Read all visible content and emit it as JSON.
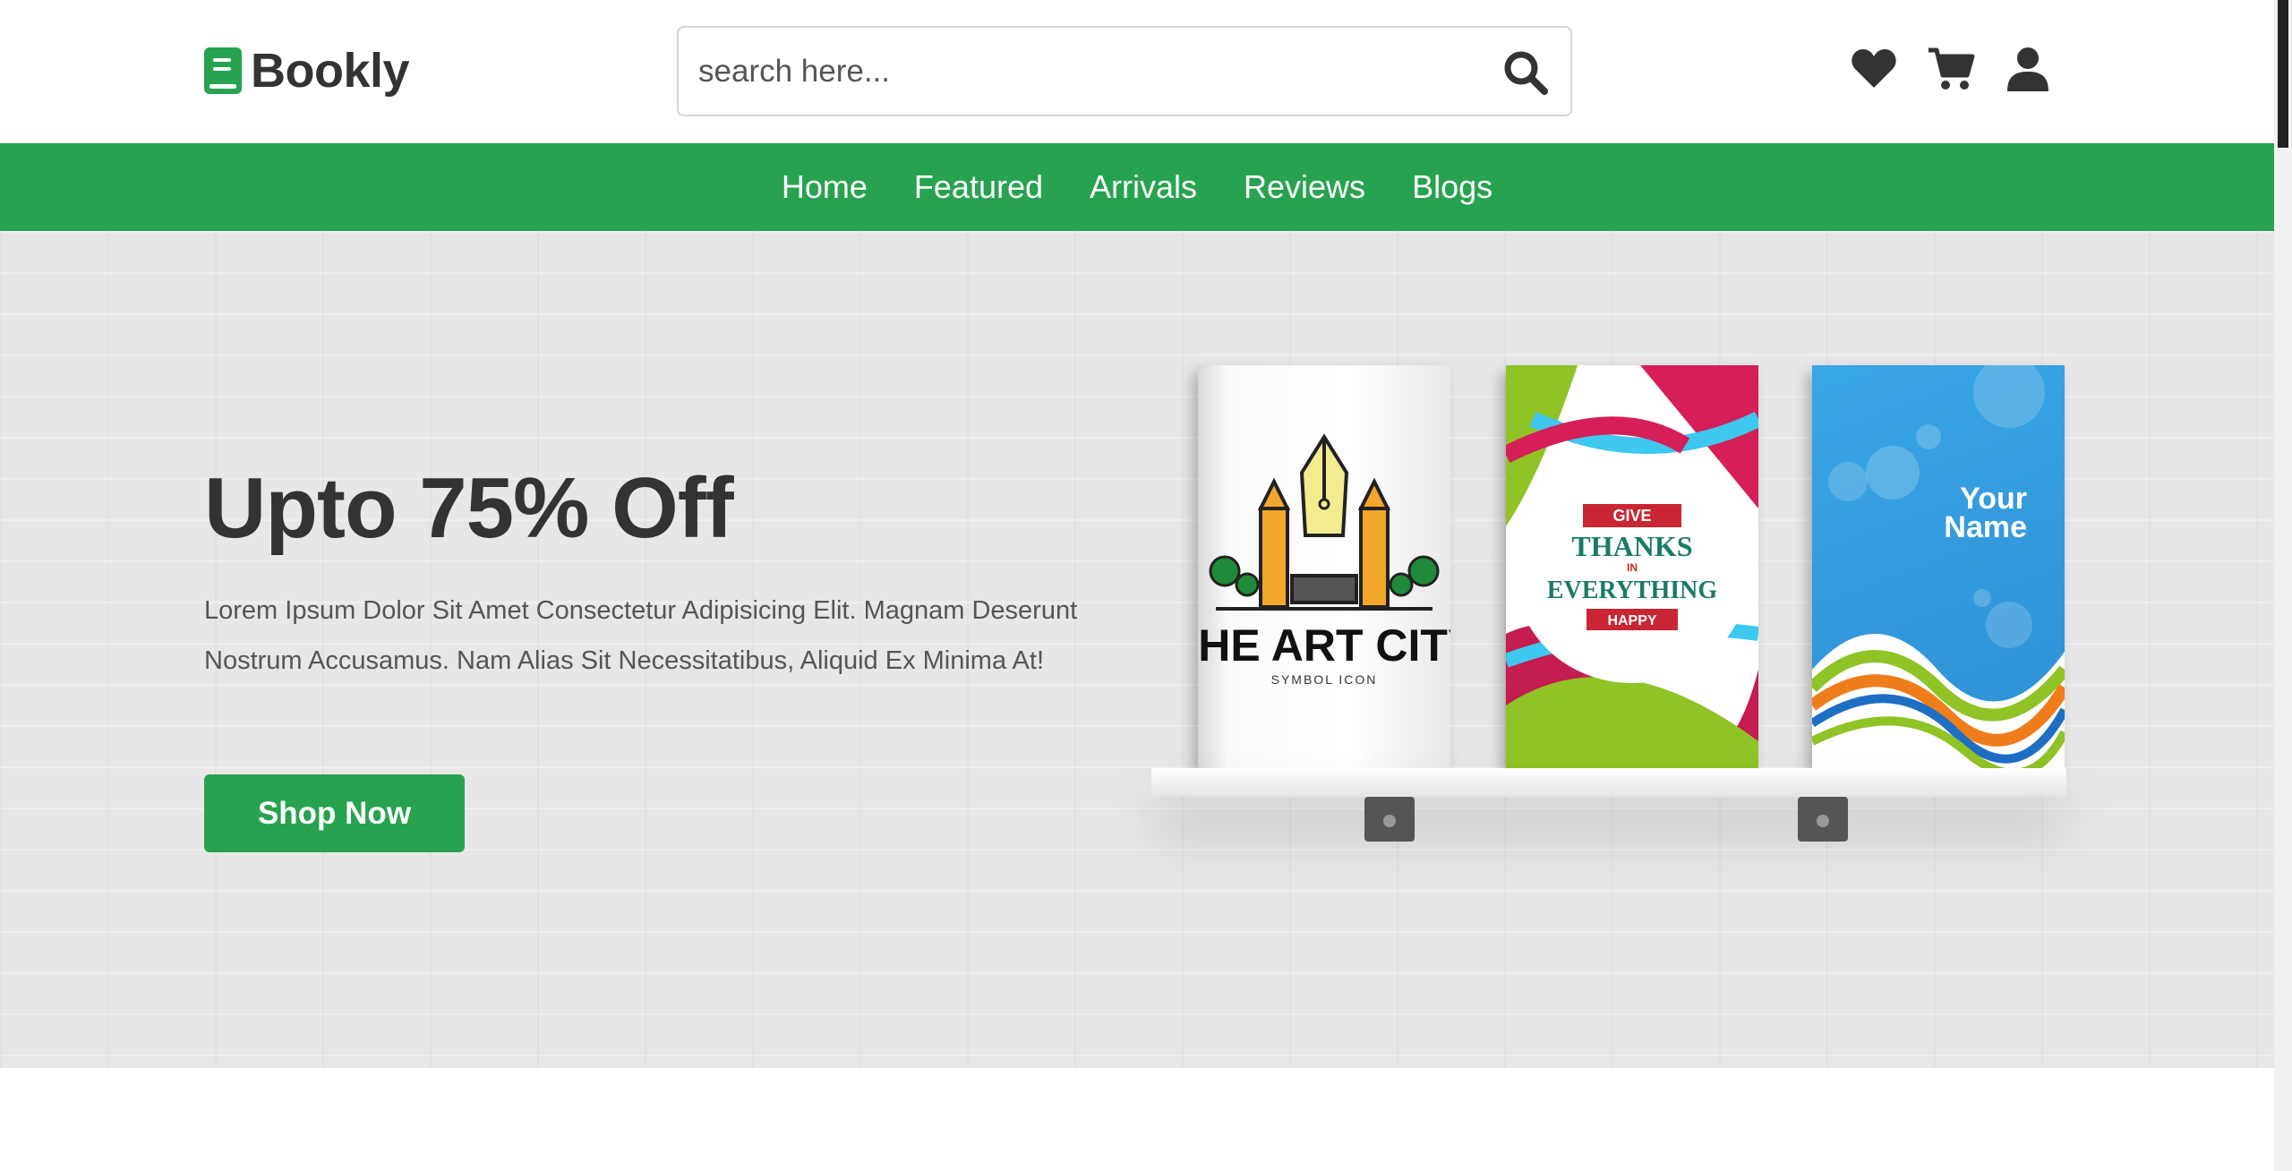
{
  "header": {
    "logo_text": "Bookly",
    "search_placeholder": "search here..."
  },
  "nav": {
    "items": [
      {
        "label": "Home"
      },
      {
        "label": "Featured"
      },
      {
        "label": "Arrivals"
      },
      {
        "label": "Reviews"
      },
      {
        "label": "Blogs"
      }
    ]
  },
  "hero": {
    "title": "Upto 75% Off",
    "text": "Lorem Ipsum Dolor Sit Amet Consectetur Adipisicing Elit. Magnam Deserunt Nostrum Accusamus. Nam Alias Sit Necessitatibus, Aliquid Ex Minima At!",
    "button_label": "Shop Now"
  },
  "books": [
    {
      "title": "THE ART CITY",
      "subtitle": "SYMBOL ICON"
    },
    {
      "line1": "GIVE",
      "line2": "THANKS",
      "line3": "IN",
      "line4": "EVERYTHING",
      "line5": "HAPPY"
    },
    {
      "line1": "Your",
      "line2": "Name"
    }
  ],
  "colors": {
    "brand_green": "#27a34f",
    "text_dark": "#333333"
  },
  "icons": [
    "book-logo-icon",
    "search-icon",
    "heart-icon",
    "cart-icon",
    "user-icon"
  ]
}
